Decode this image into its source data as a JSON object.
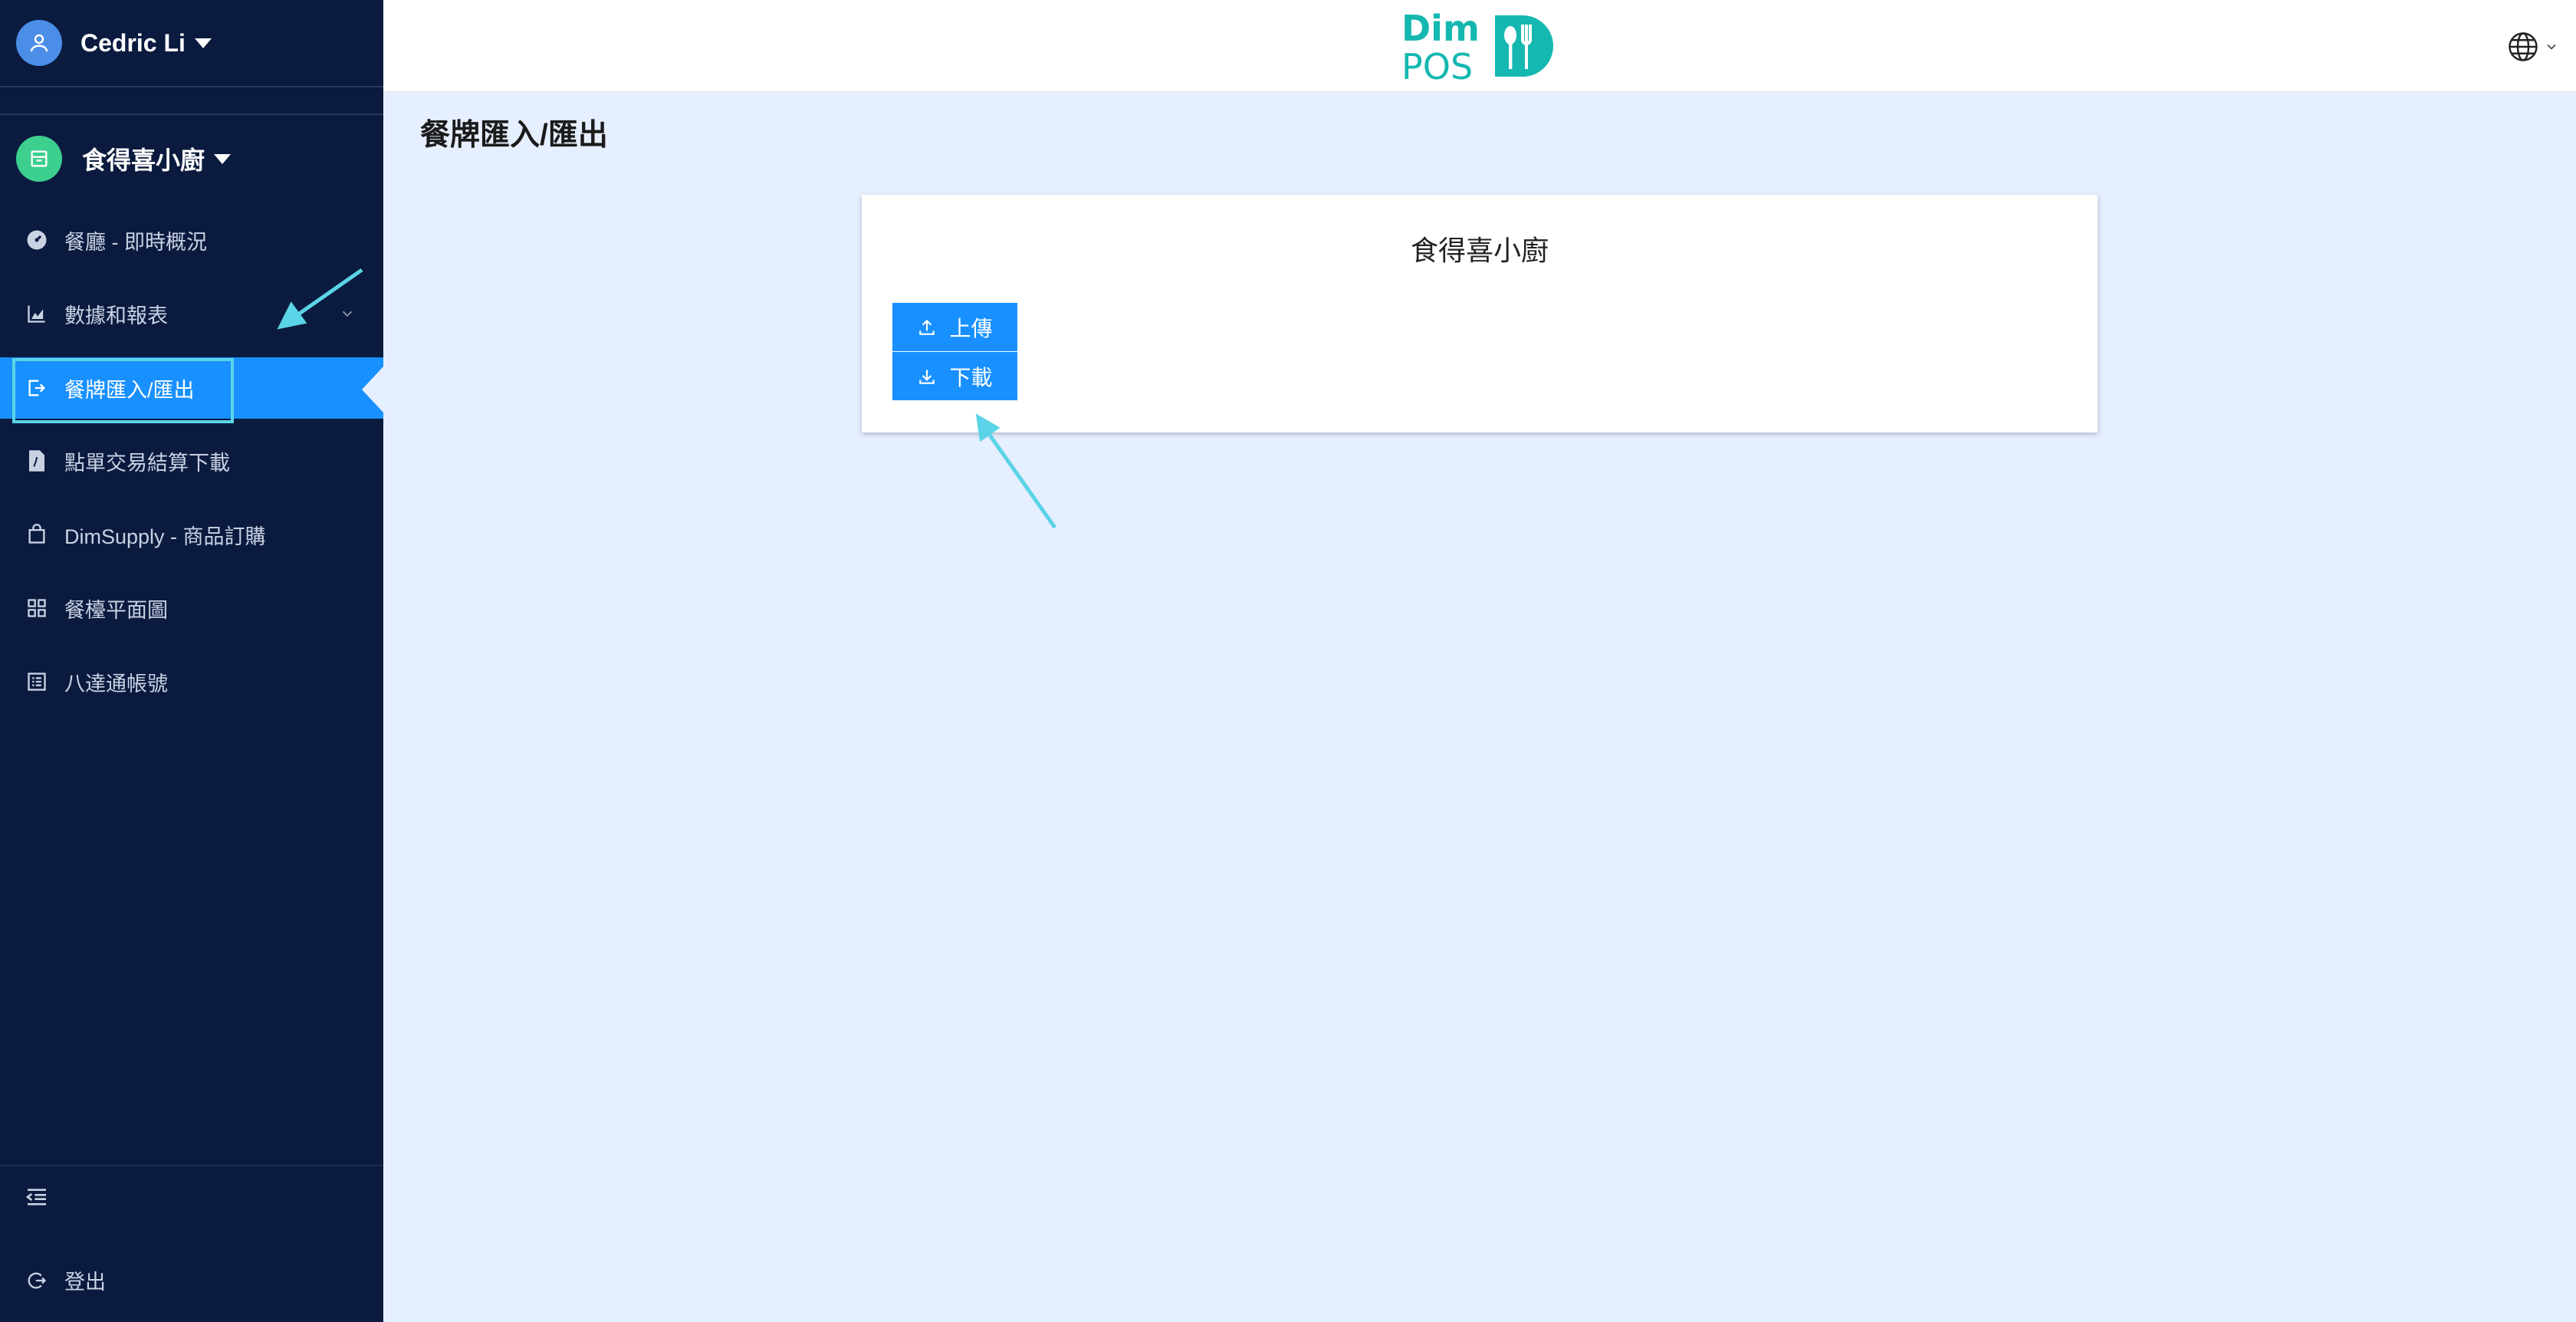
{
  "user": {
    "name": "Cedric Li"
  },
  "shop": {
    "name": "食得喜小廚"
  },
  "sidebar": {
    "items": [
      {
        "label": "餐廳 - 即時概況",
        "icon": "dashboard-icon"
      },
      {
        "label": "數據和報表",
        "icon": "area-chart-icon"
      },
      {
        "label": "餐牌匯入/匯出",
        "icon": "export-icon"
      },
      {
        "label": "點單交易結算下載",
        "icon": "file-pdf-icon"
      },
      {
        "label": "DimSupply - 商品訂購",
        "icon": "shopping-bag-icon"
      },
      {
        "label": "餐檯平面圖",
        "icon": "appstore-icon"
      },
      {
        "label": "八達通帳號",
        "icon": "profile-icon"
      }
    ],
    "logout_label": "登出"
  },
  "header": {
    "logo_line1": "Dim",
    "logo_line2": "POS"
  },
  "page": {
    "title": "餐牌匯入/匯出"
  },
  "card": {
    "title": "食得喜小廚",
    "upload_label": "上傳",
    "download_label": "下載"
  },
  "colors": {
    "sidebar_bg": "#0b1b3f",
    "accent": "#1890ff",
    "brand": "#15b8b0",
    "main_bg": "#e6efff",
    "annotation": "#5ad4e6"
  }
}
